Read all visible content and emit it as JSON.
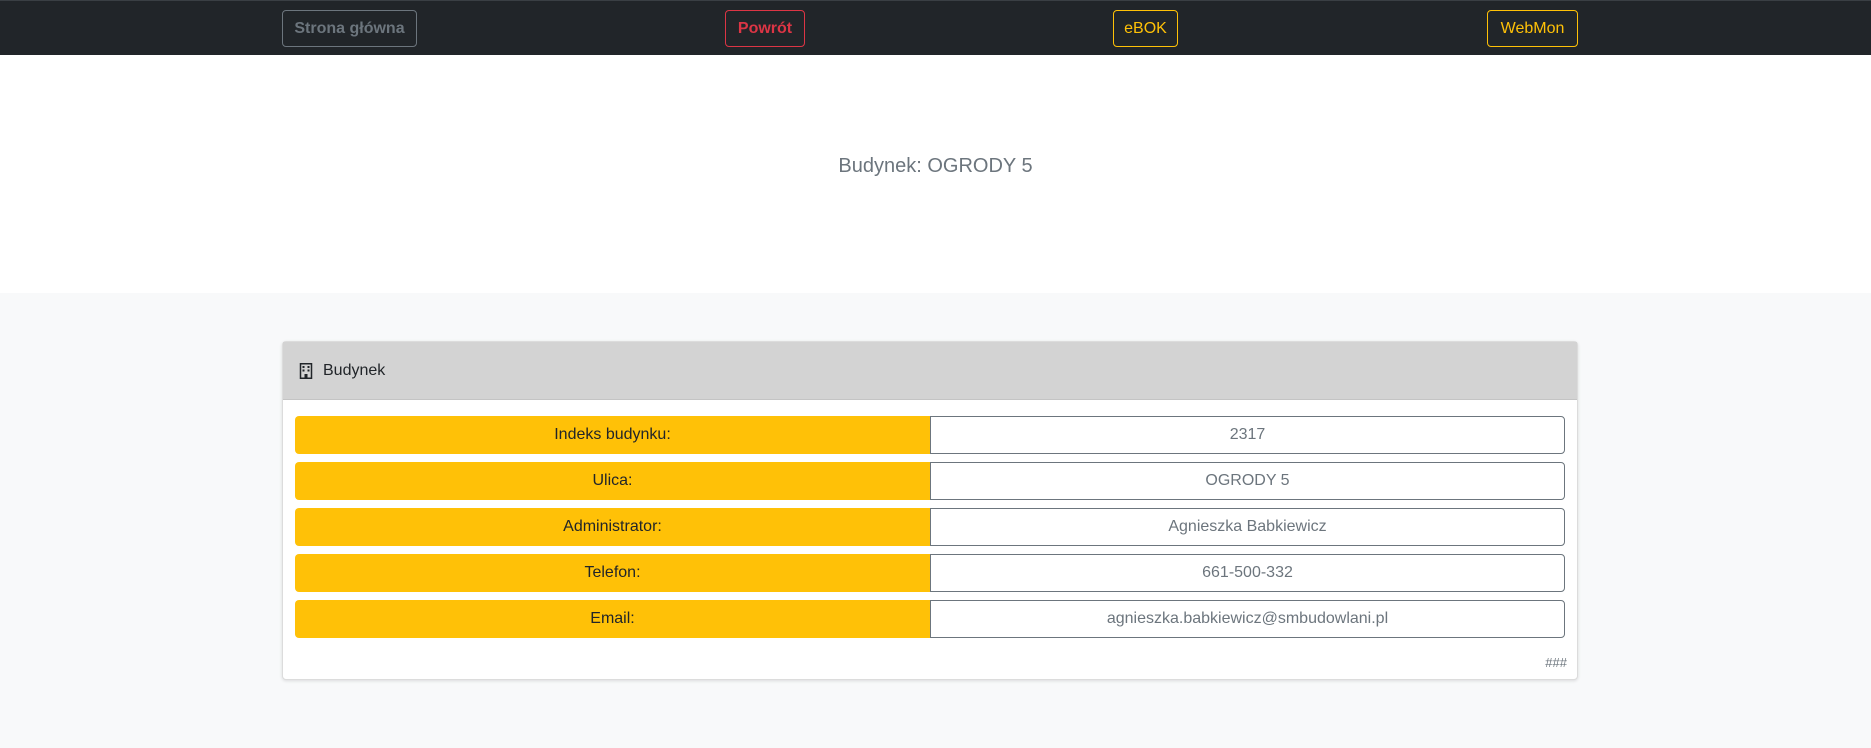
{
  "nav": {
    "home": "Strona główna",
    "back": "Powrót",
    "ebok": "eBOK",
    "webmon": "WebMon"
  },
  "hero": {
    "title": "Budynek: OGRODY 5"
  },
  "card": {
    "header_icon": "building-icon",
    "header_title": "Budynek",
    "rows": [
      {
        "label": "Indeks budynku:",
        "value": "2317"
      },
      {
        "label": "Ulica:",
        "value": "OGRODY 5"
      },
      {
        "label": "Administrator:",
        "value": "Agnieszka Babkiewicz"
      },
      {
        "label": "Telefon:",
        "value": "661-500-332"
      },
      {
        "label": "Email:",
        "value": "agnieszka.babkiewicz@smbudowlani.pl"
      }
    ],
    "footer": "###"
  },
  "colors": {
    "navbar": "#212529",
    "warning": "#ffc107",
    "danger": "#dc3545",
    "secondary": "#6c757d",
    "card_header": "#d3d3d3"
  }
}
